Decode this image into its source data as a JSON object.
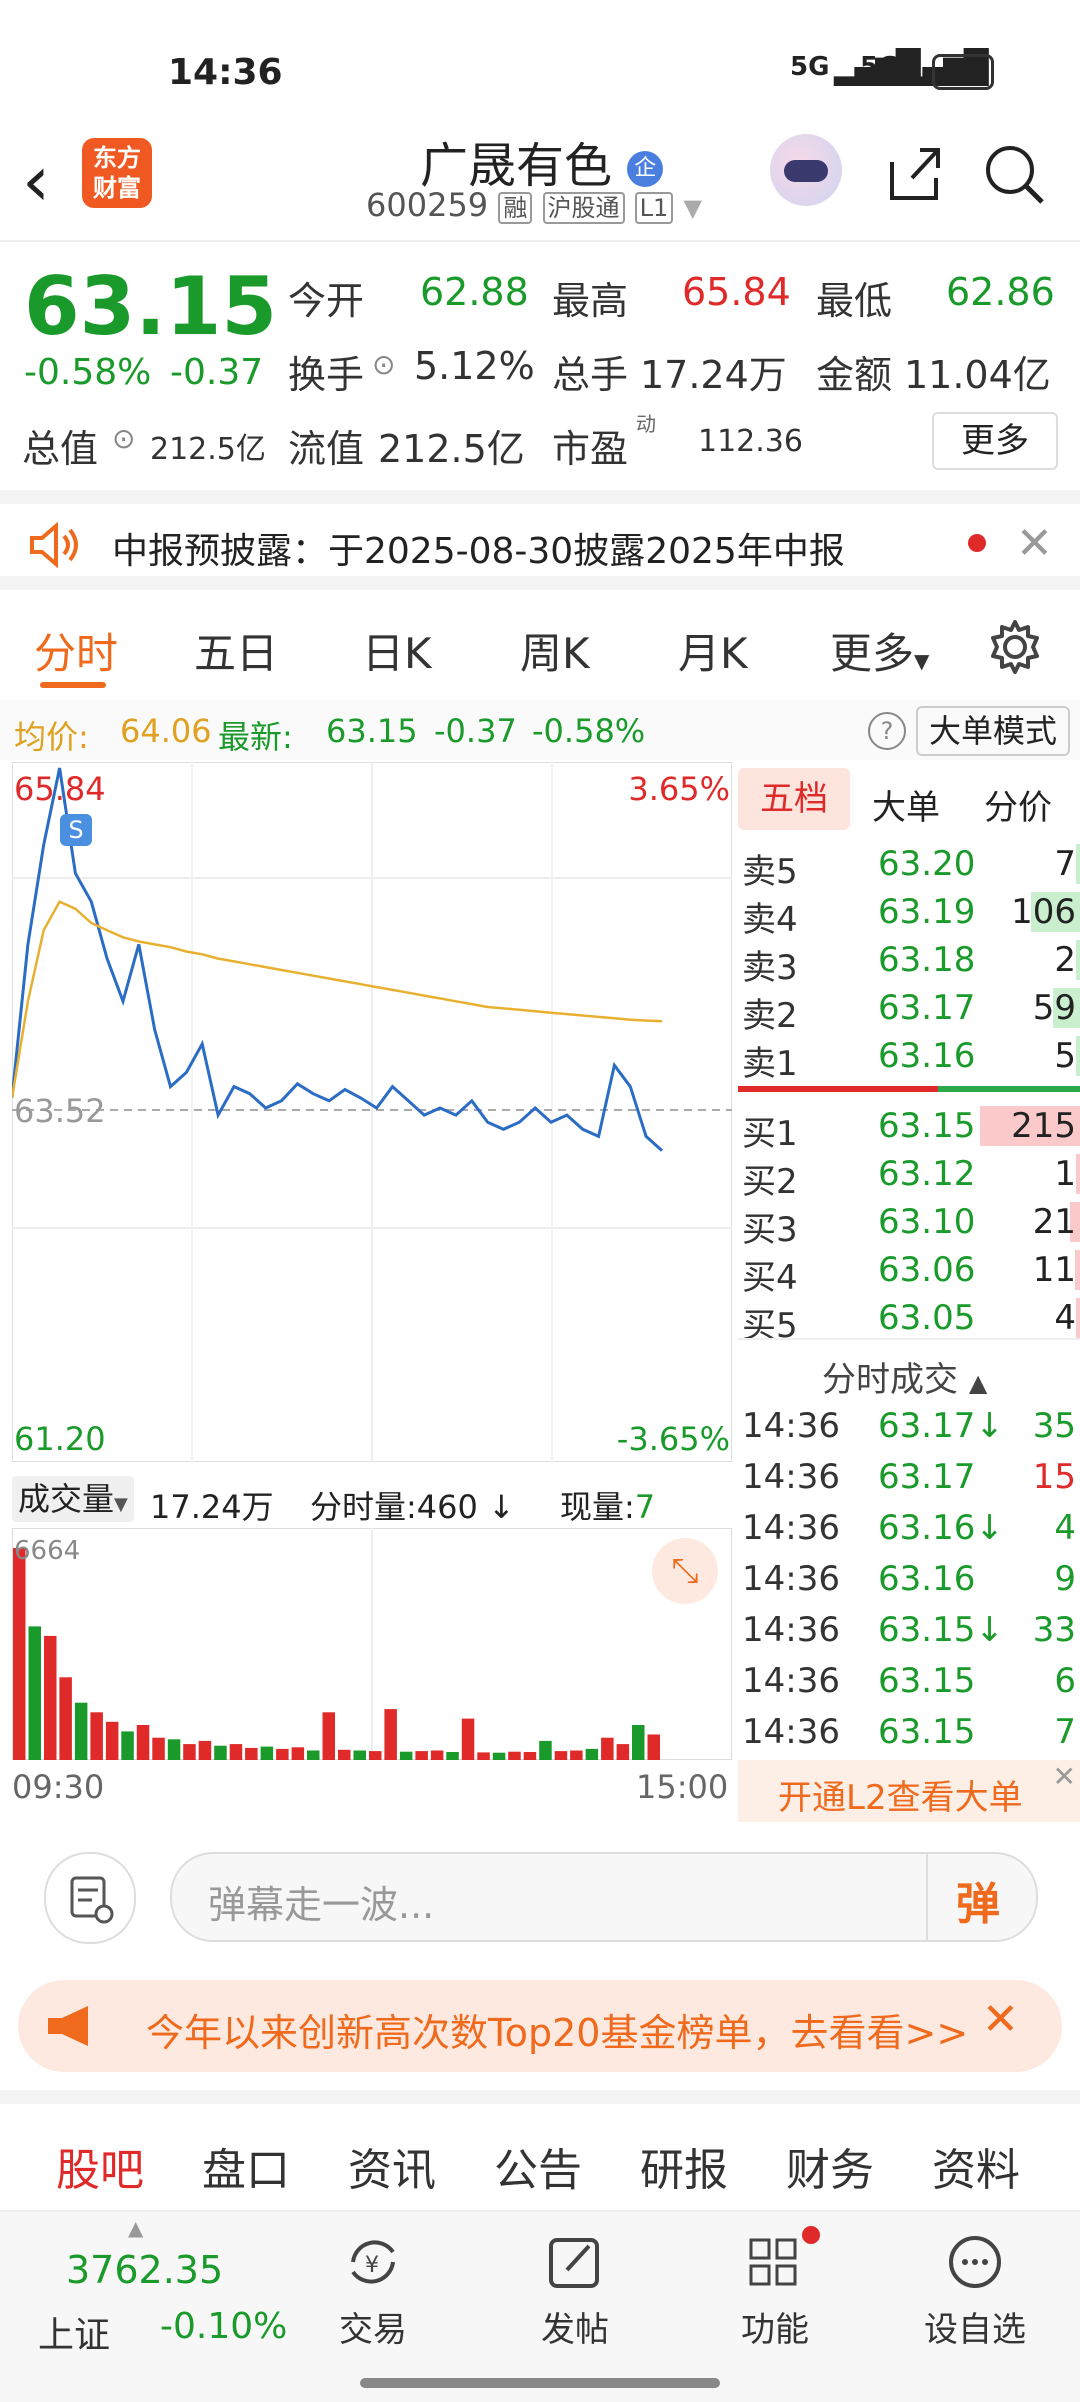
{
  "status": {
    "time": "14:36",
    "signal1": "5G",
    "signal2": "5G",
    "battery": "42"
  },
  "header": {
    "title": "广晟有色",
    "badge": "企",
    "code": "600259",
    "tags": [
      "融",
      "沪股通",
      "L1"
    ],
    "logo_line1": "东方",
    "logo_line2": "财富"
  },
  "quote": {
    "price": "63.15",
    "change_pct": "-0.58%",
    "change": "-0.37",
    "open_label": "今开",
    "open": "62.88",
    "high_label": "最高",
    "high": "65.84",
    "low_label": "最低",
    "low": "62.86",
    "turnover_label": "换手",
    "turnover": "5.12%",
    "volume_label": "总手",
    "volume": "17.24万",
    "amount_label": "金额",
    "amount": "11.04亿",
    "mktcap_label": "总值",
    "mktcap": "212.5亿",
    "float_label": "流值",
    "float": "212.5亿",
    "pe_label": "市盈",
    "pe_sup": "动",
    "pe": "112.36",
    "more_button": "更多"
  },
  "notice": {
    "text": "中报预披露：于2025-08-30披露2025年中报"
  },
  "tabs": {
    "items": [
      "分时",
      "五日",
      "日K",
      "周K",
      "月K",
      "更多"
    ]
  },
  "infoline": {
    "avg_label": "均价:",
    "avg": "64.06",
    "latest_label": "最新:",
    "latest": "63.15",
    "chg": "-0.37",
    "pct": "-0.58%",
    "mode_button": "大单模式"
  },
  "chart": {
    "high": "65.84",
    "high_pct": "3.65%",
    "mid": "63.52",
    "low": "61.20",
    "low_pct": "-3.65%",
    "s_marker": "S",
    "start_time": "09:30",
    "end_time": "15:00"
  },
  "chart_data": {
    "type": "line",
    "series": [
      {
        "name": "price",
        "values": [
          63.52,
          64.6,
          65.3,
          65.84,
          65.1,
          64.9,
          64.5,
          64.2,
          64.6,
          64.0,
          63.6,
          63.7,
          63.9,
          63.4,
          63.6,
          63.55,
          63.45,
          63.5,
          63.62,
          63.55,
          63.5,
          63.58,
          63.52,
          63.45,
          63.6,
          63.5,
          63.4,
          63.45,
          63.4,
          63.5,
          63.35,
          63.3,
          63.35,
          63.45,
          63.35,
          63.4,
          63.3,
          63.25,
          63.75,
          63.6,
          63.25,
          63.15
        ]
      },
      {
        "name": "avg",
        "values": [
          63.52,
          64.2,
          64.7,
          64.9,
          64.85,
          64.75,
          64.7,
          64.65,
          64.62,
          64.6,
          64.58,
          64.55,
          64.53,
          64.5,
          64.48,
          64.46,
          64.44,
          64.42,
          64.4,
          64.38,
          64.36,
          64.34,
          64.32,
          64.3,
          64.28,
          64.26,
          64.24,
          64.22,
          64.2,
          64.18,
          64.16,
          64.15,
          64.14,
          64.13,
          64.12,
          64.11,
          64.1,
          64.09,
          64.08,
          64.07,
          64.065,
          64.06
        ]
      }
    ],
    "volume_max": "6664",
    "volume_values": [
      6664,
      4200,
      3900,
      2600,
      1800,
      1500,
      1200,
      900,
      1100,
      700,
      650,
      500,
      600,
      450,
      500,
      380,
      420,
      350,
      400,
      300,
      1500,
      320,
      300,
      280,
      1600,
      260,
      280,
      300,
      250,
      1300,
      240,
      230,
      260,
      250,
      600,
      280,
      300,
      350,
      700,
      500,
      1100,
      800
    ],
    "ylim": [
      61.2,
      65.84
    ]
  },
  "volume_bar": {
    "label": "成交量",
    "total": "17.24万",
    "per_label": "分时量:460",
    "now_label": "现量:",
    "now": "7"
  },
  "book": {
    "tabs": [
      "五档",
      "大单",
      "分价"
    ],
    "asks": [
      {
        "label": "卖5",
        "price": "63.20",
        "qty": "7"
      },
      {
        "label": "卖4",
        "price": "63.19",
        "qty": "106"
      },
      {
        "label": "卖3",
        "price": "63.18",
        "qty": "2"
      },
      {
        "label": "卖2",
        "price": "63.17",
        "qty": "59"
      },
      {
        "label": "卖1",
        "price": "63.16",
        "qty": "5"
      }
    ],
    "bids": [
      {
        "label": "买1",
        "price": "63.15",
        "qty": "215"
      },
      {
        "label": "买2",
        "price": "63.12",
        "qty": "1"
      },
      {
        "label": "买3",
        "price": "63.10",
        "qty": "21"
      },
      {
        "label": "买4",
        "price": "63.06",
        "qty": "11"
      },
      {
        "label": "买5",
        "price": "63.05",
        "qty": "4"
      }
    ],
    "ticks_title": "分时成交",
    "ticks": [
      {
        "time": "14:36",
        "price": "63.17",
        "arrow": "↓",
        "qty": "35",
        "color": "#1a9a2a"
      },
      {
        "time": "14:36",
        "price": "63.17",
        "arrow": "",
        "qty": "15",
        "color": "#e02a2a"
      },
      {
        "time": "14:36",
        "price": "63.16",
        "arrow": "↓",
        "qty": "4",
        "color": "#1a9a2a"
      },
      {
        "time": "14:36",
        "price": "63.16",
        "arrow": "",
        "qty": "9",
        "color": "#1a9a2a"
      },
      {
        "time": "14:36",
        "price": "63.15",
        "arrow": "↓",
        "qty": "33",
        "color": "#1a9a2a"
      },
      {
        "time": "14:36",
        "price": "63.15",
        "arrow": "",
        "qty": "6",
        "color": "#1a9a2a"
      },
      {
        "time": "14:36",
        "price": "63.15",
        "arrow": "",
        "qty": "7",
        "color": "#1a9a2a"
      }
    ],
    "l2_button": "开通L2查看大单"
  },
  "comment": {
    "placeholder": "弹幕走一波...",
    "danmu_button": "弹"
  },
  "banner": {
    "text": "今年以来创新高次数Top20基金榜单，去看看>>"
  },
  "bottom_tabs": [
    "股吧",
    "盘口",
    "资讯",
    "公告",
    "研报",
    "财务",
    "资料"
  ],
  "footer": {
    "index_value": "3762.35",
    "index_name": "上证",
    "index_pct": "-0.10%",
    "items": [
      "交易",
      "发帖",
      "功能",
      "设自选"
    ]
  }
}
